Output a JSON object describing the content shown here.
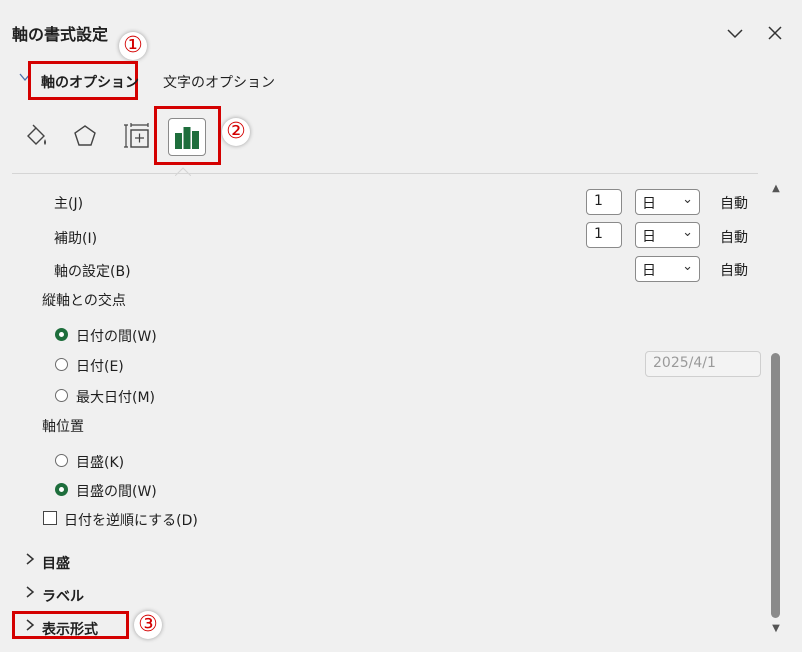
{
  "header": {
    "title": "軸の書式設定",
    "collapse_icon": "chevron-down-icon",
    "close_icon": "close-icon"
  },
  "callouts": [
    "①",
    "②",
    "③"
  ],
  "tabs": {
    "axis_options": "軸のオプション",
    "text_options": "文字のオプション"
  },
  "icons": [
    "fill-line-icon",
    "effects-pentagon-icon",
    "size-properties-icon",
    "axis-options-chart-icon"
  ],
  "units": {
    "major": {
      "label": "主(J)",
      "value": "1",
      "unit": "日",
      "auto": "自動"
    },
    "minor": {
      "label": "補助(I)",
      "value": "1",
      "unit": "日",
      "auto": "自動"
    },
    "base": {
      "label": "軸の設定(B)",
      "unit": "日",
      "auto": "自動"
    }
  },
  "vertical_cross": {
    "heading": "縦軸との交点",
    "options": [
      {
        "label": "日付の間(W)",
        "selected": true
      },
      {
        "label": "日付(E)",
        "selected": false
      },
      {
        "label": "最大日付(M)",
        "selected": false
      }
    ],
    "date_value": "2025/4/1"
  },
  "axis_position": {
    "heading": "軸位置",
    "options": [
      {
        "label": "目盛(K)",
        "selected": false
      },
      {
        "label": "目盛の間(W)",
        "selected": true
      }
    ]
  },
  "reverse_order": {
    "label": "日付を逆順にする(D)",
    "checked": false
  },
  "sections": [
    "目盛",
    "ラベル",
    "表示形式"
  ],
  "colors": {
    "accent_red": "#d40000",
    "chart_green": "#1e6e3c"
  }
}
